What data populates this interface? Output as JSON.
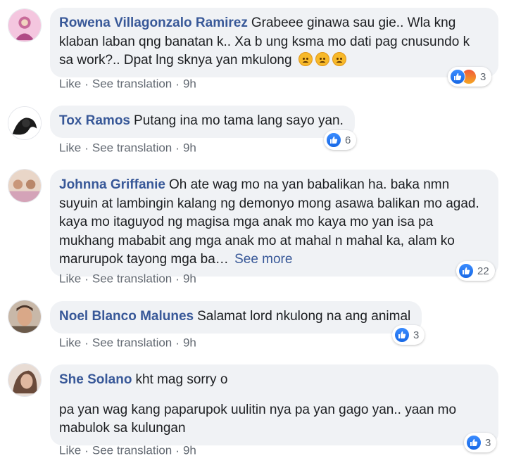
{
  "comments": [
    {
      "author": "Rowena Villagonzalo Ramirez",
      "text": "Grabeee ginawa sau gie.. Wla kng klaban laban qng banatan k.. Xa b ung ksma mo dati pag cnusundo k sa work?.. Dpat lng sknya yan mkulong",
      "emoji": [
        "angry-face",
        "angry-face",
        "angry-face"
      ],
      "like_label": "Like",
      "translate_label": "See translation",
      "time": "9h",
      "reaction_types": [
        "like",
        "angry"
      ],
      "reaction_count": "3"
    },
    {
      "author": "Tox Ramos",
      "text": "Putang ina mo tama lang sayo yan.",
      "like_label": "Like",
      "translate_label": "See translation",
      "time": "9h",
      "reaction_types": [
        "like"
      ],
      "reaction_count": "6"
    },
    {
      "author": "Johnna Griffanie",
      "text": "Oh ate wag mo na yan babalikan ha. baka nmn suyuin at lambingin kalang ng demonyo mong asawa balikan mo agad. kaya mo itaguyod ng magisa mga anak mo kaya mo yan isa pa mukhang mababit ang mga anak mo at mahal n mahal ka, alam ko marurupok tayong mga ba…",
      "see_more_label": "See more",
      "like_label": "Like",
      "translate_label": "See translation",
      "time": "9h",
      "reaction_types": [
        "like"
      ],
      "reaction_count": "22"
    },
    {
      "author": "Noel Blanco Malunes",
      "text": "Salamat lord nkulong na ang animal",
      "like_label": "Like",
      "translate_label": "See translation",
      "time": "9h",
      "reaction_types": [
        "like"
      ],
      "reaction_count": "3"
    },
    {
      "author": "She Solano",
      "text": "kht mag sorry o",
      "text2": "pa yan wag kang paparupok uulitin nya pa yan gago yan.. yaan mo mabulok sa kulungan",
      "like_label": "Like",
      "translate_label": "See translation",
      "time": "9h",
      "reaction_types": [
        "like"
      ],
      "reaction_count": "3"
    }
  ],
  "colors": {
    "author": "#385898",
    "bubble_bg": "#f0f2f5",
    "meta_text": "#606770",
    "like_blue": "#1877f2",
    "angry_red": "#f05a3c"
  }
}
